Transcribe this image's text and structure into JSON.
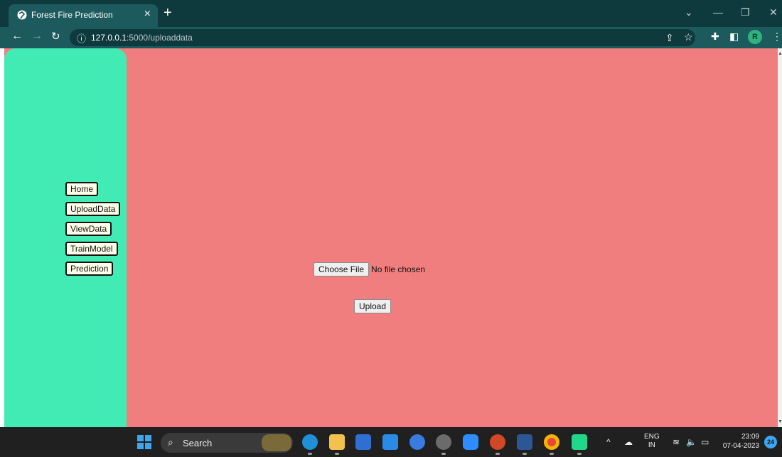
{
  "browser": {
    "tab_title": "Forest Fire Prediction",
    "tab_close": "×",
    "new_tab": "+",
    "url_host": "127.0.0.1",
    "url_path": ":5000/uploaddata",
    "profile_initial": "R",
    "window_controls": {
      "dropdown": "⌄",
      "minimize": "—",
      "restore": "❐",
      "close": "✕"
    },
    "icons": [
      "back-icon",
      "forward-icon",
      "reload-icon",
      "site-info-icon",
      "share-icon",
      "bookmark-star-icon",
      "extensions-icon",
      "side-panel-icon",
      "menu-icon"
    ]
  },
  "page": {
    "bg_color": "#f07e7e",
    "sidebar_color": "#43ebb4",
    "nav": [
      {
        "label": "Home"
      },
      {
        "label": "UploadData"
      },
      {
        "label": "ViewData"
      },
      {
        "label": "TrainModel"
      },
      {
        "label": "Prediction"
      }
    ],
    "file_input": {
      "button_label": "Choose File",
      "status": "No file chosen"
    },
    "upload_button": "Upload"
  },
  "taskbar": {
    "search_label": "Search",
    "language_line1": "ENG",
    "language_line2": "IN",
    "time": "23:09",
    "date": "07-04-2023",
    "notification_count": "24",
    "apps": [
      "edge-icon",
      "file-explorer-icon",
      "store-icon",
      "mylp-icon",
      "help-icon",
      "settings-icon",
      "zoom-icon",
      "powerpoint-icon",
      "word-icon",
      "chrome-icon",
      "pycharm-icon"
    ]
  }
}
